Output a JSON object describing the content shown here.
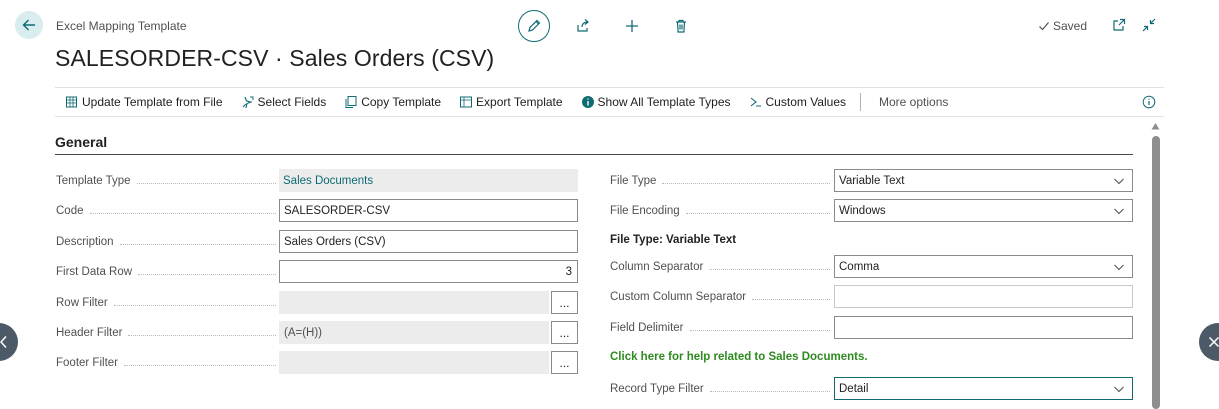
{
  "header": {
    "breadcrumb": "Excel Mapping Template",
    "title": "SALESORDER-CSV · Sales Orders (CSV)",
    "saved_label": "Saved"
  },
  "actions": [
    {
      "label": "Update Template from File",
      "icon": "template-update-icon"
    },
    {
      "label": "Select Fields",
      "icon": "select-fields-icon"
    },
    {
      "label": "Copy Template",
      "icon": "copy-icon"
    },
    {
      "label": "Export Template",
      "icon": "export-icon"
    },
    {
      "label": "Show All Template Types",
      "icon": "info-icon"
    },
    {
      "label": "Custom Values",
      "icon": "custom-values-icon"
    }
  ],
  "more_options": "More options",
  "general": {
    "title": "General",
    "left": {
      "template_type": {
        "label": "Template Type",
        "value": "Sales Documents"
      },
      "code": {
        "label": "Code",
        "value": "SALESORDER-CSV"
      },
      "description": {
        "label": "Description",
        "value": "Sales Orders (CSV)"
      },
      "first_data_row": {
        "label": "First Data Row",
        "value": "3"
      },
      "row_filter": {
        "label": "Row Filter",
        "value": ""
      },
      "header_filter": {
        "label": "Header Filter",
        "value": "(A=(H))"
      },
      "footer_filter": {
        "label": "Footer Filter",
        "value": ""
      },
      "ellipsis": "..."
    },
    "right": {
      "file_type": {
        "label": "File Type",
        "value": "Variable Text"
      },
      "file_encoding": {
        "label": "File Encoding",
        "value": "Windows"
      },
      "subheading": "File Type: Variable Text",
      "column_separator": {
        "label": "Column Separator",
        "value": "Comma"
      },
      "custom_column_separator": {
        "label": "Custom Column Separator",
        "value": ""
      },
      "field_delimiter": {
        "label": "Field Delimiter",
        "value": ""
      },
      "help_link": "Click here for help related to Sales Documents.",
      "record_type_filter": {
        "label": "Record Type Filter",
        "value": "Detail"
      }
    }
  },
  "colors": {
    "accent": "#0f6b73",
    "link_green": "#2e8b1f",
    "nav_circle": "#4b5a66"
  }
}
